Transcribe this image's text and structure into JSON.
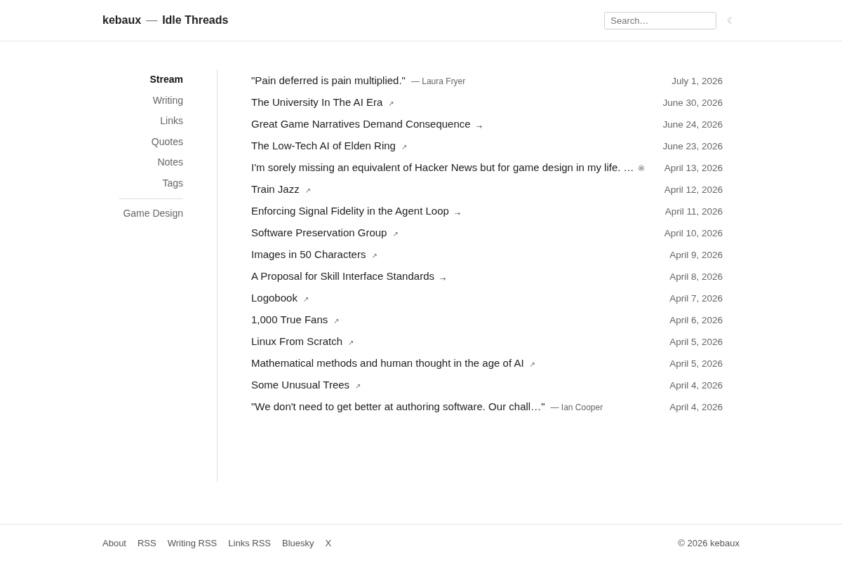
{
  "header": {
    "site_name": "kebaux",
    "separator": "—",
    "title": "Idle Threads",
    "search": {
      "placeholder": "Search…"
    },
    "theme_toggle": "☾"
  },
  "sidebar": {
    "items": [
      {
        "label": "Stream",
        "selected": true
      },
      {
        "label": "Writing",
        "selected": false
      },
      {
        "label": "Links",
        "selected": false
      },
      {
        "label": "Quotes",
        "selected": false
      },
      {
        "label": "Notes",
        "selected": false
      },
      {
        "label": "Tags",
        "selected": false
      }
    ],
    "tags": [
      {
        "label": "Game Design",
        "selected": false
      }
    ]
  },
  "stream": [
    {
      "kind": "quote",
      "text": "\"Pain deferred is pain multiplied.\"",
      "attribution": "— Laura Fryer",
      "date": "July 1, 2026"
    },
    {
      "kind": "link",
      "title": "The University In The AI Era",
      "marker": "↗",
      "date": "June 30, 2026"
    },
    {
      "kind": "post",
      "title": "Great Game Narratives Demand Consequence",
      "marker": "→",
      "date": "June 24, 2026"
    },
    {
      "kind": "link",
      "title": "The Low-Tech AI of Elden Ring",
      "marker": "↗",
      "date": "June 23, 2026"
    },
    {
      "kind": "note",
      "title": "I'm sorely missing an equivalent of Hacker News but for game design in my life. …",
      "marker": "※",
      "date": "April 13, 2026"
    },
    {
      "kind": "link",
      "title": "Train Jazz",
      "marker": "↗",
      "date": "April 12, 2026"
    },
    {
      "kind": "post",
      "title": "Enforcing Signal Fidelity in the Agent Loop",
      "marker": "→",
      "date": "April 11, 2026"
    },
    {
      "kind": "link",
      "title": "Software Preservation Group",
      "marker": "↗",
      "date": "April 10, 2026"
    },
    {
      "kind": "link",
      "title": "Images in 50 Characters",
      "marker": "↗",
      "date": "April 9, 2026"
    },
    {
      "kind": "post",
      "title": "A Proposal for Skill Interface Standards",
      "marker": "→",
      "date": "April 8, 2026"
    },
    {
      "kind": "link",
      "title": "Logobook",
      "marker": "↗",
      "date": "April 7, 2026"
    },
    {
      "kind": "link",
      "title": "1,000 True Fans",
      "marker": "↗",
      "date": "April 6, 2026"
    },
    {
      "kind": "link",
      "title": "Linux From Scratch",
      "marker": "↗",
      "date": "April 5, 2026"
    },
    {
      "kind": "link",
      "title": "Mathematical methods and human thought in the age of AI",
      "marker": "↗",
      "date": "April 5, 2026"
    },
    {
      "kind": "link",
      "title": "Some Unusual Trees",
      "marker": "↗",
      "date": "April 4, 2026"
    },
    {
      "kind": "quote",
      "text": "\"We don't need to get better at authoring software. Our chall…\"",
      "attribution": "— Ian Cooper",
      "date": "April 4, 2026"
    }
  ],
  "footer": {
    "links": [
      "About",
      "RSS",
      "Writing RSS",
      "Links RSS",
      "Bluesky",
      "X"
    ],
    "copyright": "© 2026 kebaux"
  }
}
